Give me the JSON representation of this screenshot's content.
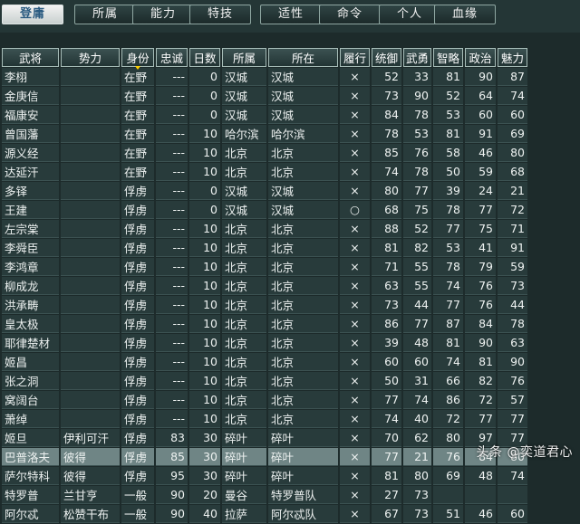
{
  "tabs": [
    {
      "label": "登庸",
      "active": true
    },
    {
      "label": "所属"
    },
    {
      "label": "能力"
    },
    {
      "label": "特技"
    },
    {
      "label": "适性"
    },
    {
      "label": "命令"
    },
    {
      "label": "个人"
    },
    {
      "label": "血缘"
    }
  ],
  "columns": [
    "武将",
    "势力",
    "身份",
    "忠诚",
    "日数",
    "所属",
    "所在",
    "履行",
    "统御",
    "武勇",
    "智略",
    "政治",
    "魅力"
  ],
  "sorted_column": "身份",
  "rows": [
    [
      "李栩",
      "",
      "在野",
      "---",
      "0",
      "汉城",
      "汉城",
      "×",
      "52",
      "33",
      "81",
      "90",
      "87"
    ],
    [
      "金庚信",
      "",
      "在野",
      "---",
      "0",
      "汉城",
      "汉城",
      "×",
      "73",
      "90",
      "52",
      "64",
      "74"
    ],
    [
      "福康安",
      "",
      "在野",
      "---",
      "0",
      "汉城",
      "汉城",
      "×",
      "84",
      "78",
      "53",
      "60",
      "60"
    ],
    [
      "曾国藩",
      "",
      "在野",
      "---",
      "10",
      "哈尔滨",
      "哈尔滨",
      "×",
      "78",
      "53",
      "81",
      "91",
      "69"
    ],
    [
      "源义经",
      "",
      "在野",
      "---",
      "10",
      "北京",
      "北京",
      "×",
      "85",
      "76",
      "58",
      "46",
      "80"
    ],
    [
      "达延汗",
      "",
      "在野",
      "---",
      "10",
      "北京",
      "北京",
      "×",
      "74",
      "78",
      "50",
      "59",
      "68"
    ],
    [
      "多铎",
      "",
      "俘虏",
      "---",
      "0",
      "汉城",
      "汉城",
      "×",
      "80",
      "77",
      "39",
      "24",
      "21"
    ],
    [
      "王建",
      "",
      "俘虏",
      "---",
      "0",
      "汉城",
      "汉城",
      "○",
      "68",
      "75",
      "78",
      "77",
      "72"
    ],
    [
      "左宗棠",
      "",
      "俘虏",
      "---",
      "10",
      "北京",
      "北京",
      "×",
      "88",
      "52",
      "77",
      "75",
      "71"
    ],
    [
      "李舜臣",
      "",
      "俘虏",
      "---",
      "10",
      "北京",
      "北京",
      "×",
      "81",
      "82",
      "53",
      "41",
      "91"
    ],
    [
      "李鸿章",
      "",
      "俘虏",
      "---",
      "10",
      "北京",
      "北京",
      "×",
      "71",
      "55",
      "78",
      "79",
      "59"
    ],
    [
      "柳成龙",
      "",
      "俘虏",
      "---",
      "10",
      "北京",
      "北京",
      "×",
      "63",
      "55",
      "74",
      "76",
      "73"
    ],
    [
      "洪承畴",
      "",
      "俘虏",
      "---",
      "10",
      "北京",
      "北京",
      "×",
      "73",
      "44",
      "77",
      "76",
      "44"
    ],
    [
      "皇太极",
      "",
      "俘虏",
      "---",
      "10",
      "北京",
      "北京",
      "×",
      "86",
      "77",
      "87",
      "84",
      "78"
    ],
    [
      "耶律楚材",
      "",
      "俘虏",
      "---",
      "10",
      "北京",
      "北京",
      "×",
      "39",
      "48",
      "81",
      "90",
      "63"
    ],
    [
      "姬昌",
      "",
      "俘虏",
      "---",
      "10",
      "北京",
      "北京",
      "×",
      "60",
      "60",
      "74",
      "81",
      "90"
    ],
    [
      "张之洞",
      "",
      "俘虏",
      "---",
      "10",
      "北京",
      "北京",
      "×",
      "50",
      "31",
      "66",
      "82",
      "76"
    ],
    [
      "窝阔台",
      "",
      "俘虏",
      "---",
      "10",
      "北京",
      "北京",
      "×",
      "77",
      "74",
      "86",
      "72",
      "57"
    ],
    [
      "萧绰",
      "",
      "俘虏",
      "---",
      "10",
      "北京",
      "北京",
      "×",
      "74",
      "40",
      "72",
      "77",
      "77"
    ],
    [
      "姬旦",
      "伊利可汗",
      "俘虏",
      "83",
      "30",
      "碎叶",
      "碎叶",
      "×",
      "70",
      "62",
      "80",
      "97",
      "77"
    ],
    [
      "巴普洛夫",
      "彼得",
      "俘虏",
      "85",
      "30",
      "碎叶",
      "碎叶",
      "×",
      "77",
      "21",
      "76",
      "84",
      "80"
    ],
    [
      "萨尔特科",
      "彼得",
      "俘虏",
      "95",
      "30",
      "碎叶",
      "碎叶",
      "×",
      "81",
      "80",
      "69",
      "48",
      "74"
    ],
    [
      "特罗普",
      "兰甘亨",
      "一般",
      "90",
      "20",
      "曼谷",
      "特罗普队",
      "×",
      "27",
      "73",
      "",
      "",
      ""
    ],
    [
      "阿尔忒",
      "松赞干布",
      "一般",
      "90",
      "40",
      "拉萨",
      "阿尔忒队",
      "×",
      "67",
      "73",
      "51",
      "46",
      "60"
    ]
  ],
  "selected_row": 20,
  "watermark": "头条 @奕道君心"
}
